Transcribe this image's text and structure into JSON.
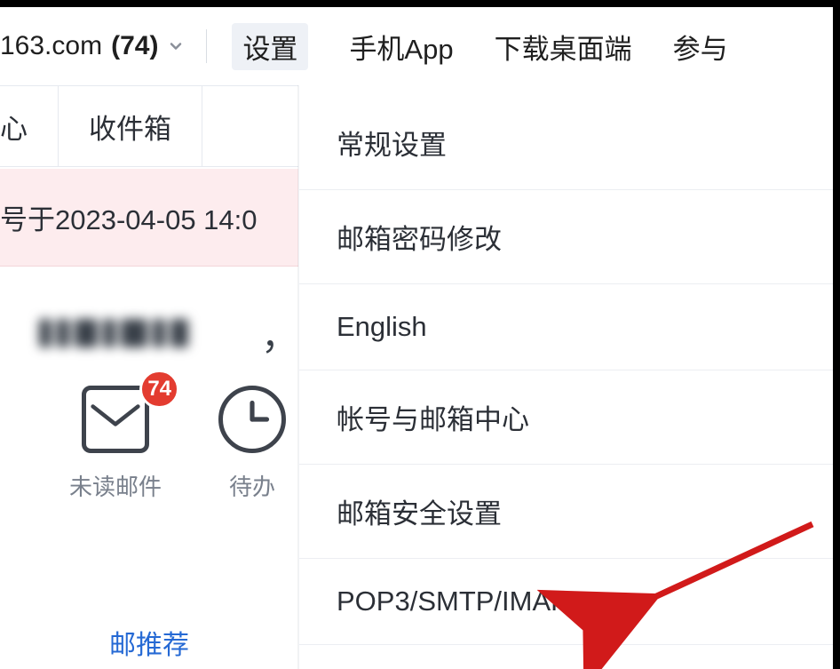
{
  "topbar": {
    "account_domain_fragment": "163.com",
    "unread_count_label": "(74)",
    "nav": {
      "settings": "设置",
      "mobile_app": "手机App",
      "download_desktop": "下载桌面端",
      "participate_fragment": "参与"
    }
  },
  "tabs": {
    "center_fragment": "心",
    "inbox": "收件箱"
  },
  "notice": {
    "text_fragment": "号于2023-04-05 14:0"
  },
  "user": {
    "name_hidden": true,
    "trailing_comma": "，"
  },
  "quick": {
    "unread": {
      "label": "未读邮件",
      "badge": "74"
    },
    "todo": {
      "label_fragment": "待办"
    }
  },
  "recommend": {
    "label_fragment": "邮推荐"
  },
  "settings_menu": {
    "items": [
      "常规设置",
      "邮箱密码修改",
      "English",
      "帐号与邮箱中心",
      "邮箱安全设置",
      "POP3/SMTP/IMAP"
    ]
  },
  "annotation": {
    "arrow_color": "#d11a1a",
    "target": "POP3/SMTP/IMAP"
  }
}
